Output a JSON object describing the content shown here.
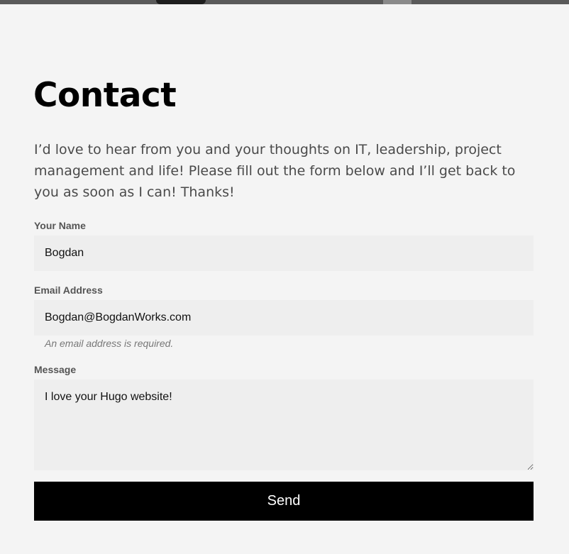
{
  "page": {
    "title": "Contact",
    "intro": "I’d love to hear from you and your thoughts on IT, leadership, project management and life! Please fill out the form below and I’ll get back to you as soon as I can! Thanks!"
  },
  "form": {
    "name": {
      "label": "Your Name",
      "value": "Bogdan"
    },
    "email": {
      "label": "Email Address",
      "value": "Bogdan@BogdanWorks.com",
      "hint": "An email address is required."
    },
    "message": {
      "label": "Message",
      "value": "I love your Hugo website!"
    },
    "submit_label": "Send"
  },
  "colors": {
    "background": "#f4f4f4",
    "field_background": "#eeeeee",
    "button_background": "#000000",
    "button_text": "#ffffff"
  }
}
